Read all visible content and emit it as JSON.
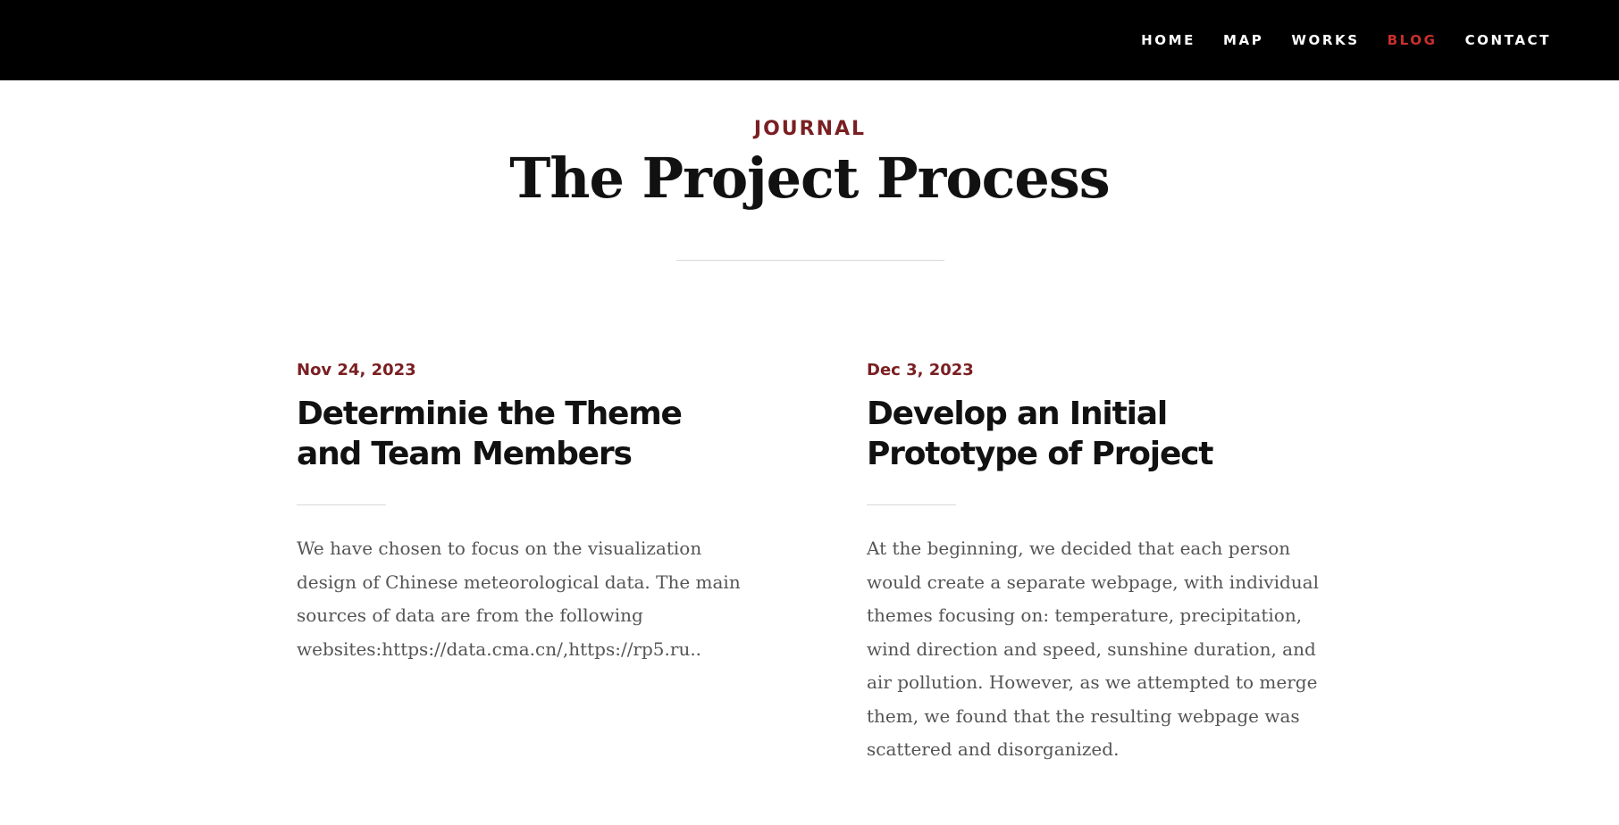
{
  "nav": {
    "items": [
      {
        "label": "HOME",
        "active": false
      },
      {
        "label": "MAP",
        "active": false
      },
      {
        "label": "WORKS",
        "active": false
      },
      {
        "label": "BLOG",
        "active": true
      },
      {
        "label": "CONTACT",
        "active": false
      }
    ]
  },
  "hero": {
    "eyebrow": "JOURNAL",
    "title": "The Project Process"
  },
  "posts": [
    {
      "date": "Nov 24, 2023",
      "title": "Determinie the Theme\nand Team Members",
      "body": "We have chosen to focus on the visualization design of Chinese meteorological data. The main sources of data are from the following websites:https://data.cma.cn/,https://rp5.ru.."
    },
    {
      "date": "Dec 3, 2023",
      "title": "Develop an Initial\nPrototype of Project",
      "body": "At the beginning, we decided that each person would create a separate webpage, with individual themes focusing on: temperature, precipitation, wind direction and speed, sunshine duration, and air pollution. However, as we attempted to merge them, we found that the resulting webpage was scattered and disorganized."
    }
  ],
  "colors": {
    "accent": "#7a1f22",
    "nav_active": "#c9302c",
    "header_bg": "#000000"
  }
}
